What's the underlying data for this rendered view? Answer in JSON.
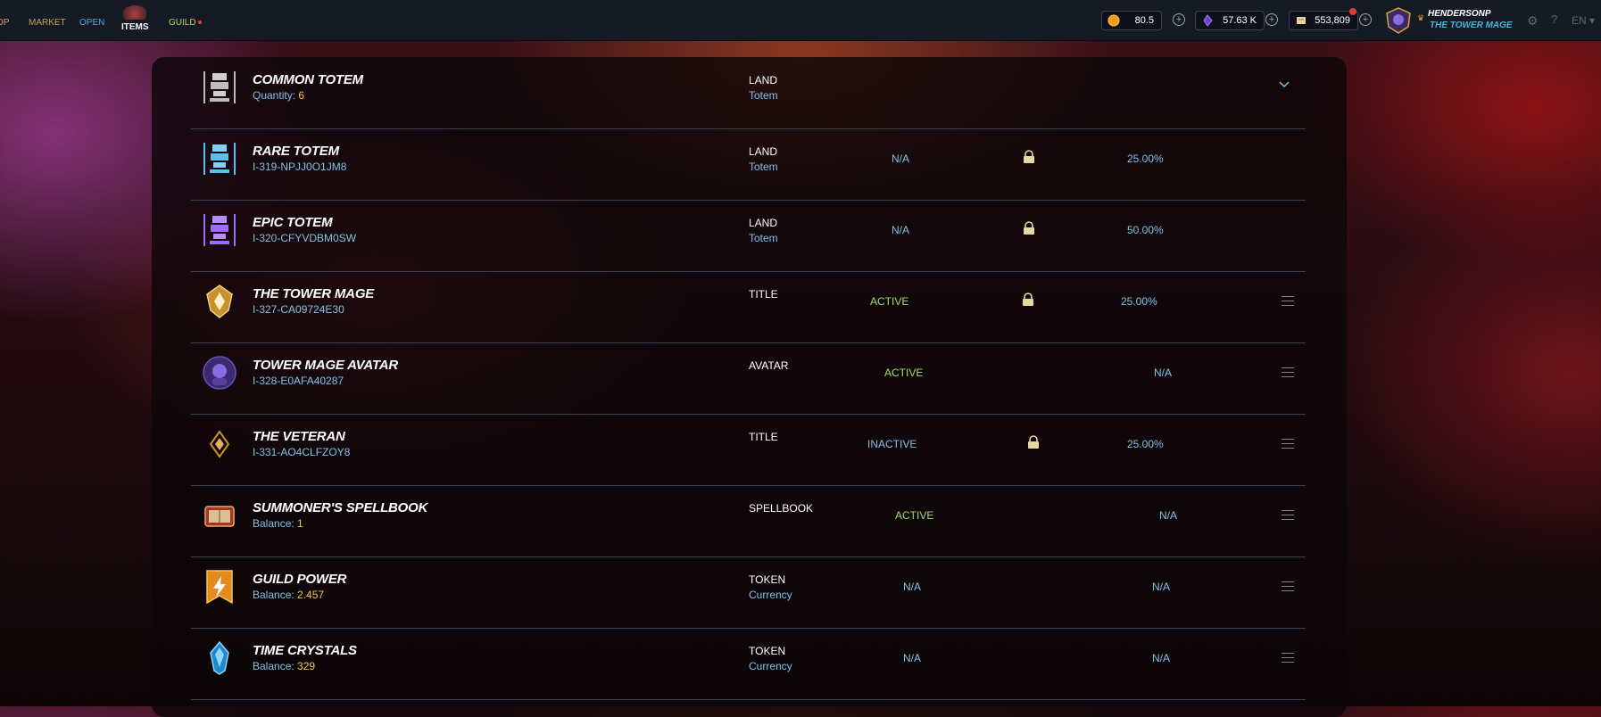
{
  "nav": {
    "shop": "OP",
    "market": "MARKET",
    "open": "OPEN",
    "items": "ITEMS",
    "guild": "GUILD"
  },
  "currencies": [
    {
      "value": "80.5",
      "icon": "orange-coin-icon"
    },
    {
      "value": "57.63 K",
      "icon": "purple-crystal-icon"
    },
    {
      "value": "553,809",
      "icon": "scroll-icon"
    }
  ],
  "user": {
    "name": "HENDERSONP",
    "title": "THE TOWER MAGE"
  },
  "lang": "EN",
  "rows": [
    {
      "name": "COMMON TOTEM",
      "sub_label": "Quantity: ",
      "sub_value": "6",
      "type": "LAND",
      "category": "Totem",
      "status": "",
      "percent": "",
      "icon": "common-totem-icon"
    },
    {
      "name": "RARE TOTEM",
      "sub_label": "I-319-NPJJ0O1JM8",
      "sub_value": "",
      "type": "LAND",
      "category": "Totem",
      "status": "N/A",
      "percent": "25.00%",
      "icon": "rare-totem-icon"
    },
    {
      "name": "EPIC TOTEM",
      "sub_label": "I-320-CFYVDBM0SW",
      "sub_value": "",
      "type": "LAND",
      "category": "Totem",
      "status": "N/A",
      "percent": "50.00%",
      "icon": "epic-totem-icon"
    },
    {
      "name": "THE TOWER MAGE",
      "sub_label": "I-327-CA09724E30",
      "sub_value": "",
      "type": "TITLE",
      "category": "",
      "status": "ACTIVE",
      "percent": "25.00%",
      "icon": "tower-mage-title-icon"
    },
    {
      "name": "TOWER MAGE AVATAR",
      "sub_label": "I-328-E0AFA40287",
      "sub_value": "",
      "type": "AVATAR",
      "category": "",
      "status": "ACTIVE",
      "percent": "N/A",
      "icon": "tower-mage-avatar-icon"
    },
    {
      "name": "THE VETERAN",
      "sub_label": "I-331-AO4CLFZOY8",
      "sub_value": "",
      "type": "TITLE",
      "category": "",
      "status": "INACTIVE",
      "percent": "25.00%",
      "icon": "veteran-title-icon"
    },
    {
      "name": "SUMMONER'S SPELLBOOK",
      "sub_label": "Balance: ",
      "sub_value": "1",
      "type": "SPELLBOOK",
      "category": "",
      "status": "ACTIVE",
      "percent": "N/A",
      "icon": "spellbook-icon"
    },
    {
      "name": "GUILD POWER",
      "sub_label": "Balance: ",
      "sub_value": "2.457",
      "type": "TOKEN",
      "category": "Currency",
      "status": "N/A",
      "percent": "N/A",
      "icon": "guild-power-icon"
    },
    {
      "name": "TIME CRYSTALS",
      "sub_label": "Balance: ",
      "sub_value": "329",
      "type": "TOKEN",
      "category": "Currency",
      "status": "N/A",
      "percent": "N/A",
      "icon": "time-crystal-icon"
    }
  ],
  "colors": {
    "accent_blue": "#7fc3e6",
    "active_green": "#9ee06a",
    "gold": "#f5c54a"
  }
}
